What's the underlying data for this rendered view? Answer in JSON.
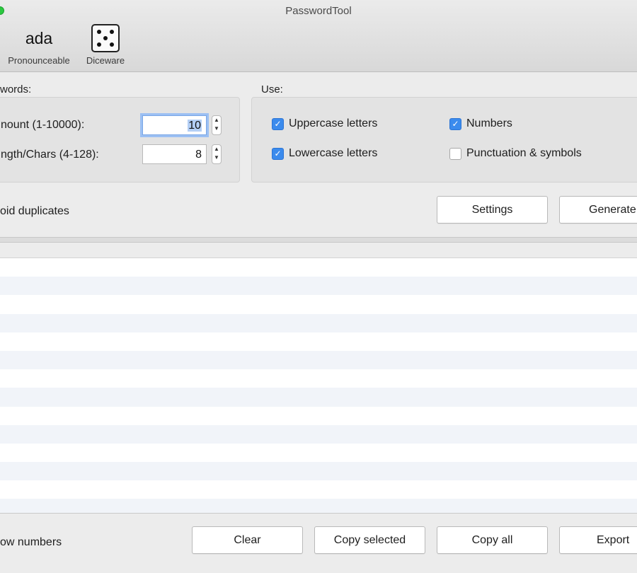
{
  "window": {
    "title": "PasswordTool"
  },
  "toolbar": {
    "tools": [
      {
        "icon_text": "ada",
        "label": "Pronounceable"
      },
      {
        "icon": "dice-five-icon",
        "label": "Diceware"
      }
    ]
  },
  "passwords_group": {
    "label": "words:",
    "amount_label": "nount (1-10000):",
    "amount_value": "10",
    "length_label": "ngth/Chars (4-128):",
    "length_value": "8"
  },
  "use_group": {
    "label": "Use:",
    "options": [
      {
        "label": "Uppercase letters",
        "checked": true
      },
      {
        "label": "Numbers",
        "checked": true
      },
      {
        "label": "Lowercase letters",
        "checked": true
      },
      {
        "label": "Punctuation & symbols",
        "checked": false
      }
    ]
  },
  "avoid_duplicates_label": "oid duplicates",
  "buttons": {
    "settings": "Settings",
    "generate": "Generate"
  },
  "bottom": {
    "show_numbers_label": "ow numbers",
    "clear": "Clear",
    "copy_selected": "Copy selected",
    "copy_all": "Copy all",
    "export": "Export"
  },
  "colors": {
    "accent": "#3b8bed",
    "row_alt": "#f1f4f9"
  }
}
